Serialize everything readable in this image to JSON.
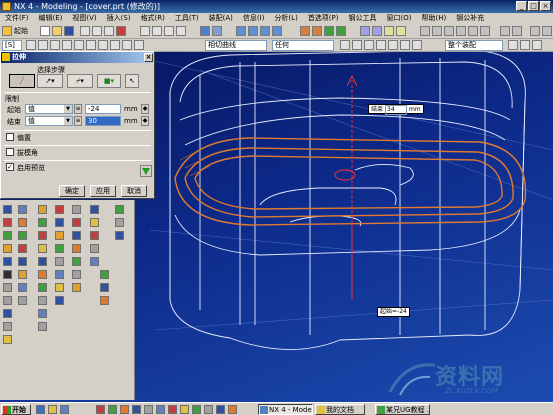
{
  "window": {
    "title": "NX 4 - Modeling - [cover.prt (修改的)]",
    "controls": [
      "_",
      "□",
      "×"
    ]
  },
  "menu": [
    "文件(F)",
    "编辑(E)",
    "视图(V)",
    "插入(S)",
    "格式(R)",
    "工具(T)",
    "装配(A)",
    "信息(I)",
    "分析(L)",
    "首选项(P)",
    "钢公工具",
    "窗口(O)",
    "帮助(H)",
    "钢公补充"
  ],
  "toolbar": {
    "start_label": "起始",
    "filter_value": "[S]",
    "selection_scope": "相切曲线",
    "snap_mode": "任何",
    "view_mode": "整个装配"
  },
  "dialog": {
    "title": "拉伸",
    "steps_label": "选择步骤",
    "limits_label": "限制",
    "start_label": "起始",
    "start_option": "值",
    "start_value": "-24",
    "end_label": "结束",
    "end_option": "值",
    "end_value": "30",
    "unit": "mm",
    "offset_label": "偏置",
    "draft_label": "拔模角",
    "preview_label": "启用预览",
    "offset_checked": false,
    "draft_checked": false,
    "preview_checked": true,
    "buttons": {
      "ok": "确定",
      "apply": "应用",
      "cancel": "取消"
    }
  },
  "viewport": {
    "end_callout_label": "结束",
    "end_callout_value": "34",
    "end_callout_unit": "mm",
    "start_callout_text": "起始=-24"
  },
  "taskbar": {
    "start": "开始",
    "items": [
      "NX 4 - Modeling ...",
      "我的文档",
      "某兄UG教程 ..."
    ]
  },
  "watermark": {
    "text": "资料网",
    "url": "ZL.XUZLK.COM"
  },
  "colors": {
    "accent_orange": "#e07a30",
    "title_blue": "#0a246a",
    "viewport_top": "#06145a",
    "viewport_bottom": "#1c4cb0"
  }
}
